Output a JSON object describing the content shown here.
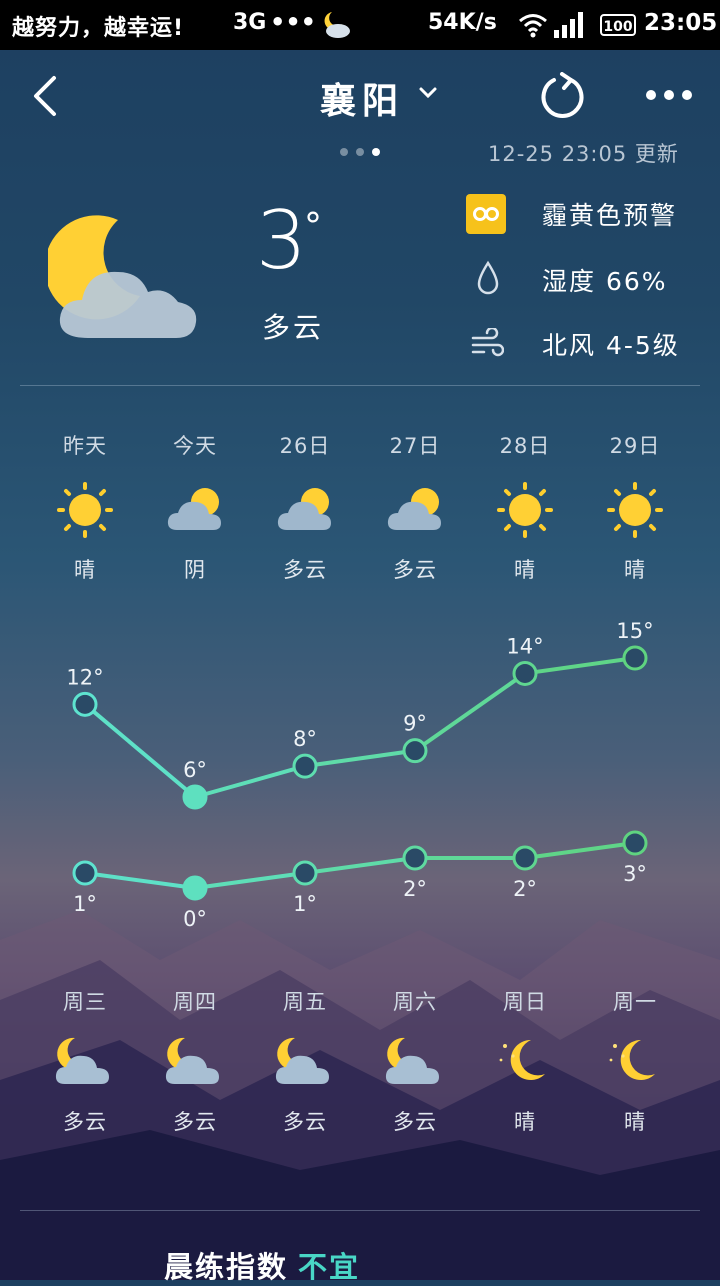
{
  "status_bar": {
    "carrier_slogan": "越努力，越幸运!",
    "network": "3G",
    "dots": "•••",
    "speed": "54K/s",
    "battery": "100",
    "time": "23:05"
  },
  "header": {
    "city": "襄阳",
    "update_time": "12-25 23:05 更新",
    "page_dots_count": 3,
    "active_page": 3
  },
  "current": {
    "temperature": "3",
    "degree_symbol": "°",
    "condition": "多云",
    "icon": "moon-cloud-icon",
    "alert": "霾黄色预警",
    "alert_color": "#f6c21b",
    "humidity": "湿度 66%",
    "wind": "北风 4-5级"
  },
  "forecast": {
    "days": [
      {
        "label": "昨天",
        "day_condition": "晴",
        "day_icon": "sun-icon",
        "high": 12,
        "low": 1,
        "weekday": "周三",
        "night_condition": "多云",
        "night_icon": "moon-cloud-icon"
      },
      {
        "label": "今天",
        "day_condition": "阴",
        "day_icon": "sun-cloud-icon",
        "high": 6,
        "low": 0,
        "weekday": "周四",
        "night_condition": "多云",
        "night_icon": "moon-cloud-icon"
      },
      {
        "label": "26日",
        "day_condition": "多云",
        "day_icon": "sun-cloud-icon",
        "high": 8,
        "low": 1,
        "weekday": "周五",
        "night_condition": "多云",
        "night_icon": "moon-cloud-icon"
      },
      {
        "label": "27日",
        "day_condition": "多云",
        "day_icon": "sun-cloud-icon",
        "high": 9,
        "low": 2,
        "weekday": "周六",
        "night_condition": "多云",
        "night_icon": "moon-cloud-icon"
      },
      {
        "label": "28日",
        "day_condition": "晴",
        "day_icon": "sun-icon",
        "high": 14,
        "low": 2,
        "weekday": "周日",
        "night_condition": "晴",
        "night_icon": "moon-stars-icon"
      },
      {
        "label": "29日",
        "day_condition": "晴",
        "day_icon": "sun-icon",
        "high": 15,
        "low": 3,
        "weekday": "周一",
        "night_condition": "晴",
        "night_icon": "moon-stars-icon"
      }
    ],
    "today_index": 1
  },
  "chart_data": {
    "type": "line",
    "categories": [
      "昨天",
      "今天",
      "26日",
      "27日",
      "28日",
      "29日"
    ],
    "series": [
      {
        "values": [
          12,
          6,
          8,
          9,
          14,
          15
        ],
        "color": "#5ee3cf"
      },
      {
        "values": [
          1,
          0,
          1,
          2,
          2,
          3
        ],
        "color": "#5ee3cf"
      }
    ],
    "unit": "°"
  },
  "morning_exercise": {
    "label": "晨练指数",
    "value": "不宜",
    "value_color": "#49d6c6"
  }
}
